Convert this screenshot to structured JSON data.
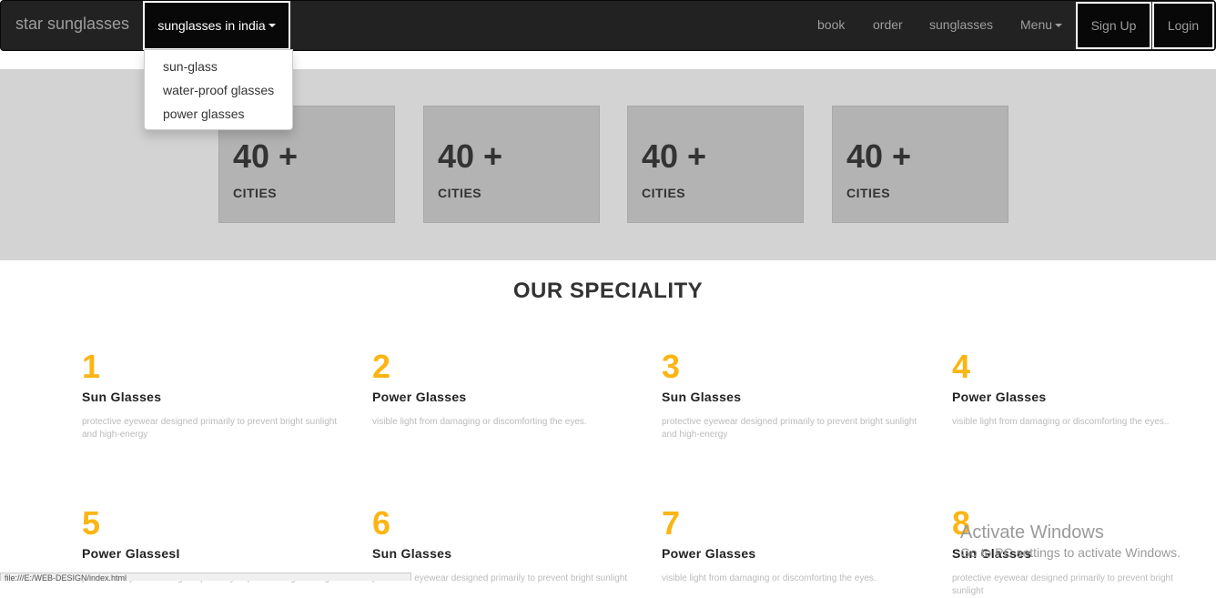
{
  "navbar": {
    "brand": "star sunglasses",
    "dropdown_label": "sunglasses in india",
    "links": [
      "book",
      "order",
      "sunglasses"
    ],
    "menu_label": "Menu",
    "signup_label": "Sign Up",
    "login_label": "Login"
  },
  "dropdown": {
    "items": [
      "sun-glass",
      "water-proof glasses",
      "power glasses"
    ]
  },
  "stats": [
    {
      "number": "40 +",
      "label": "CITIES"
    },
    {
      "number": "40 +",
      "label": "CITIES"
    },
    {
      "number": "40 +",
      "label": "CITIES"
    },
    {
      "number": "40 +",
      "label": "CITIES"
    }
  ],
  "speciality": {
    "title": "OUR SPECIALITY",
    "items": [
      {
        "num": "1",
        "title": "Sun Glasses",
        "desc": "protective eyewear designed primarily to prevent bright sunlight and high-energy"
      },
      {
        "num": "2",
        "title": "Power Glasses",
        "desc": "visible light from damaging or discomforting the eyes."
      },
      {
        "num": "3",
        "title": "Sun Glasses",
        "desc": "protective eyewear designed primarily to prevent bright sunlight and high-energy"
      },
      {
        "num": "4",
        "title": "Power Glasses",
        "desc": "visible light from damaging or discomforting the eyes.."
      },
      {
        "num": "5",
        "title": "Power GlassesI",
        "desc": "protective eyewear designed primarily to prevent bright sunlight"
      },
      {
        "num": "6",
        "title": "Sun Glasses",
        "desc": "protective eyewear designed primarily to prevent bright sunlight"
      },
      {
        "num": "7",
        "title": "Power Glasses",
        "desc": "visible light from damaging or discomforting the eyes."
      },
      {
        "num": "8",
        "title": "Sun Glasses",
        "desc": "protective eyewear designed primarily to prevent bright sunlight"
      }
    ]
  },
  "watermark": {
    "title": "Activate Windows",
    "subtitle": "Go to PC settings to activate Windows."
  },
  "statusbar": {
    "text": "file:///E:/WEB-DESIGN/index.html"
  },
  "colors": {
    "navbar_bg": "#222222",
    "accent_number": "#fbb514",
    "stats_band": "#d3d3d3",
    "stat_card": "#b3b3b3"
  }
}
